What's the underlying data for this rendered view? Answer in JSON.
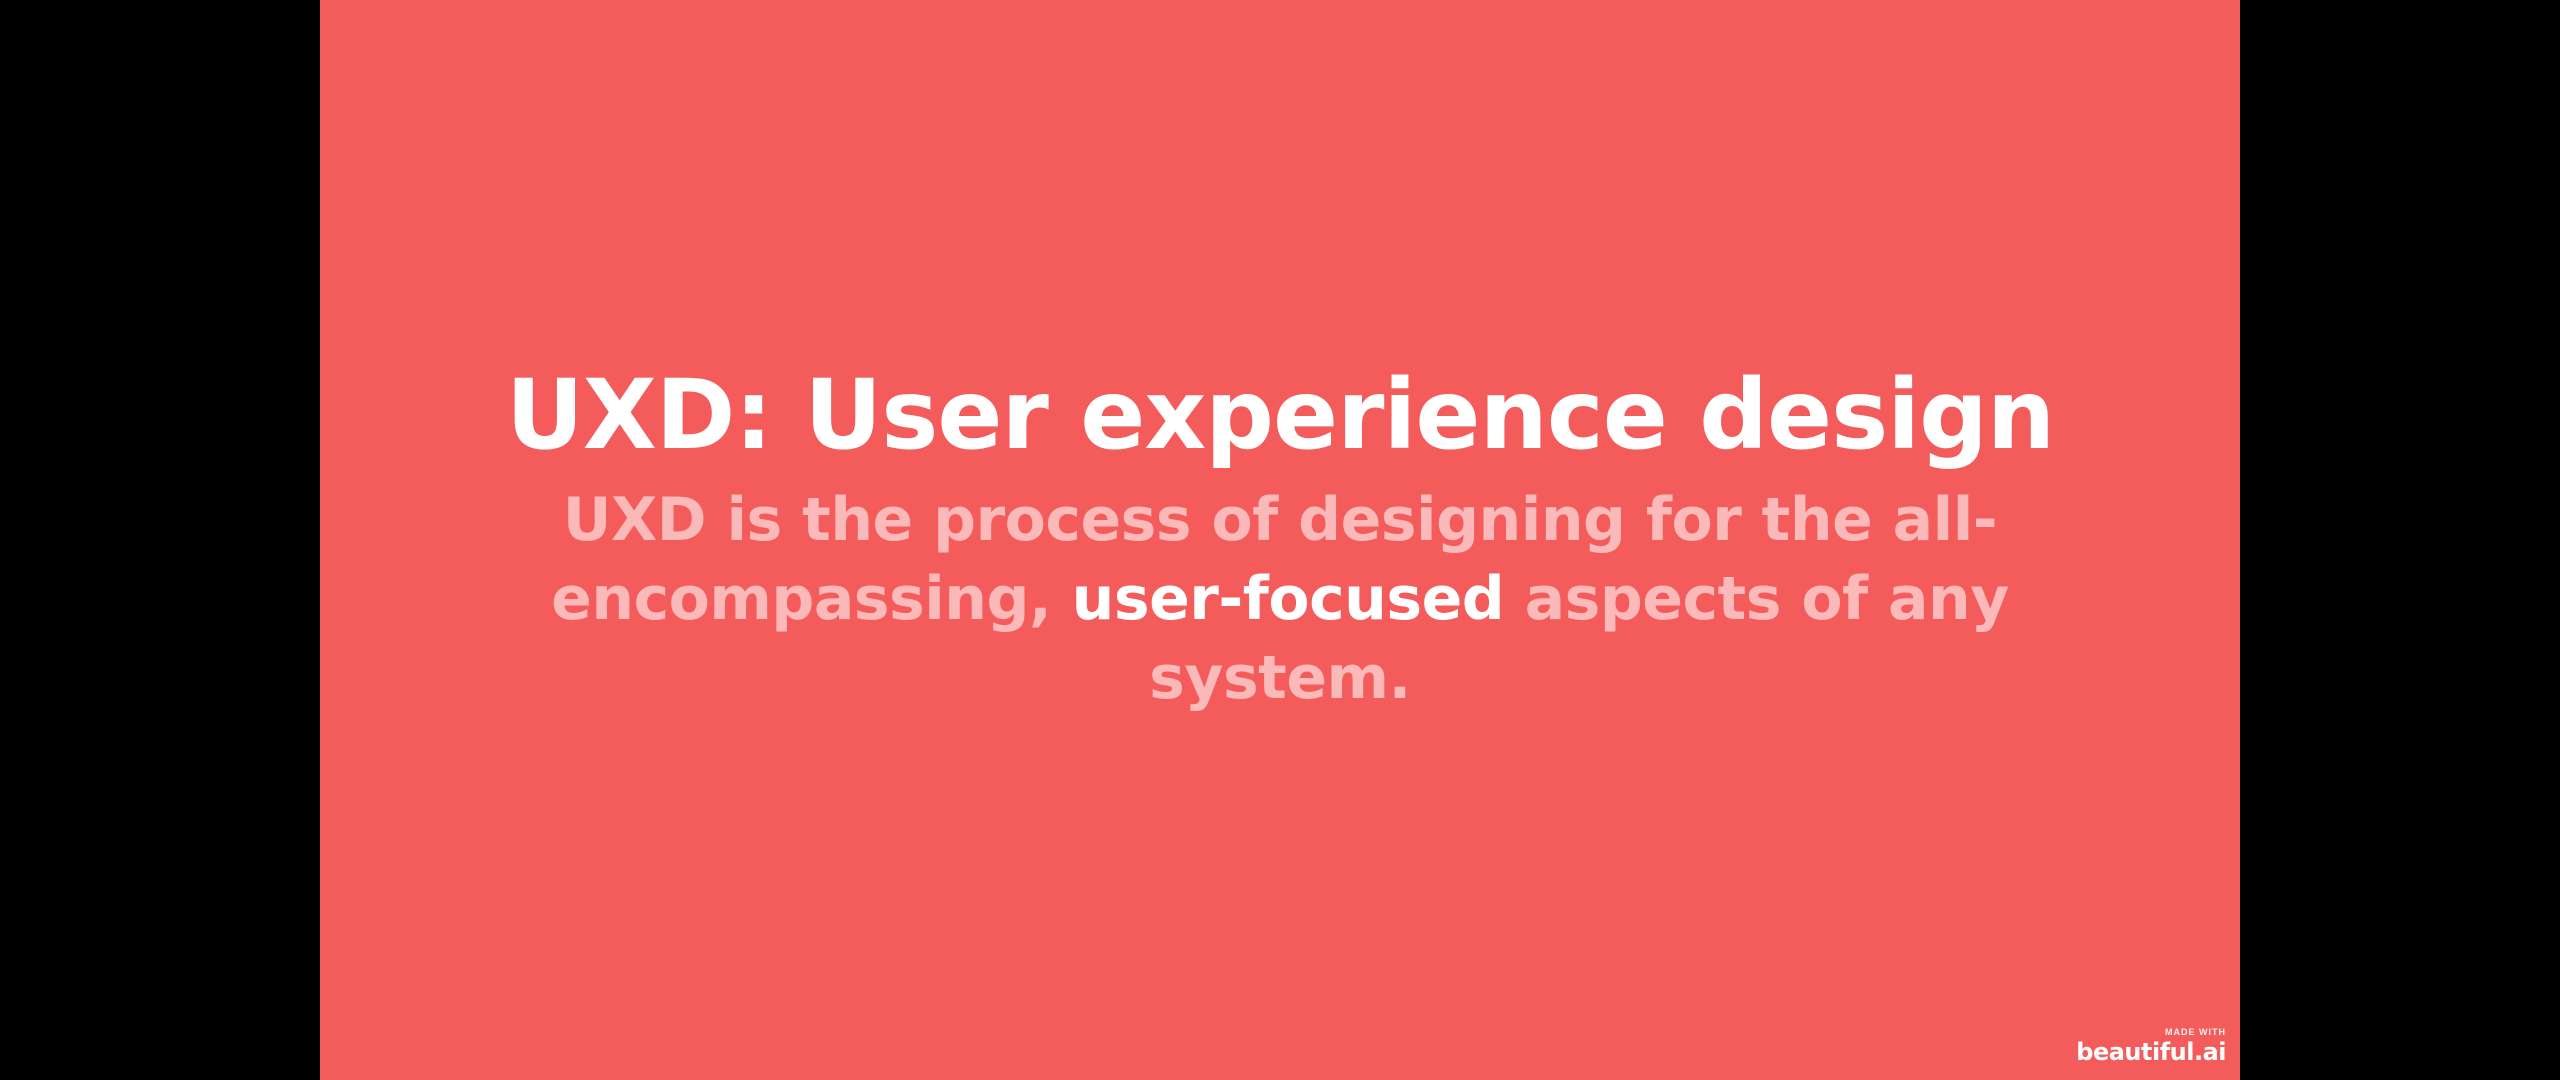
{
  "slide": {
    "title": "UXD: User experience design",
    "body": {
      "before": "UXD is the process of designing for the all-encompassing, ",
      "highlight": "user-focused",
      "after": " aspects of any system."
    }
  },
  "badge": {
    "made_with": "MADE WITH",
    "brand": "beautiful.ai"
  },
  "colors": {
    "background": "#000000",
    "slide_background": "#F45C5C",
    "title_text": "#FFFFFF",
    "body_text": "#FBB9B9",
    "highlight_text": "#FFFFFF"
  }
}
